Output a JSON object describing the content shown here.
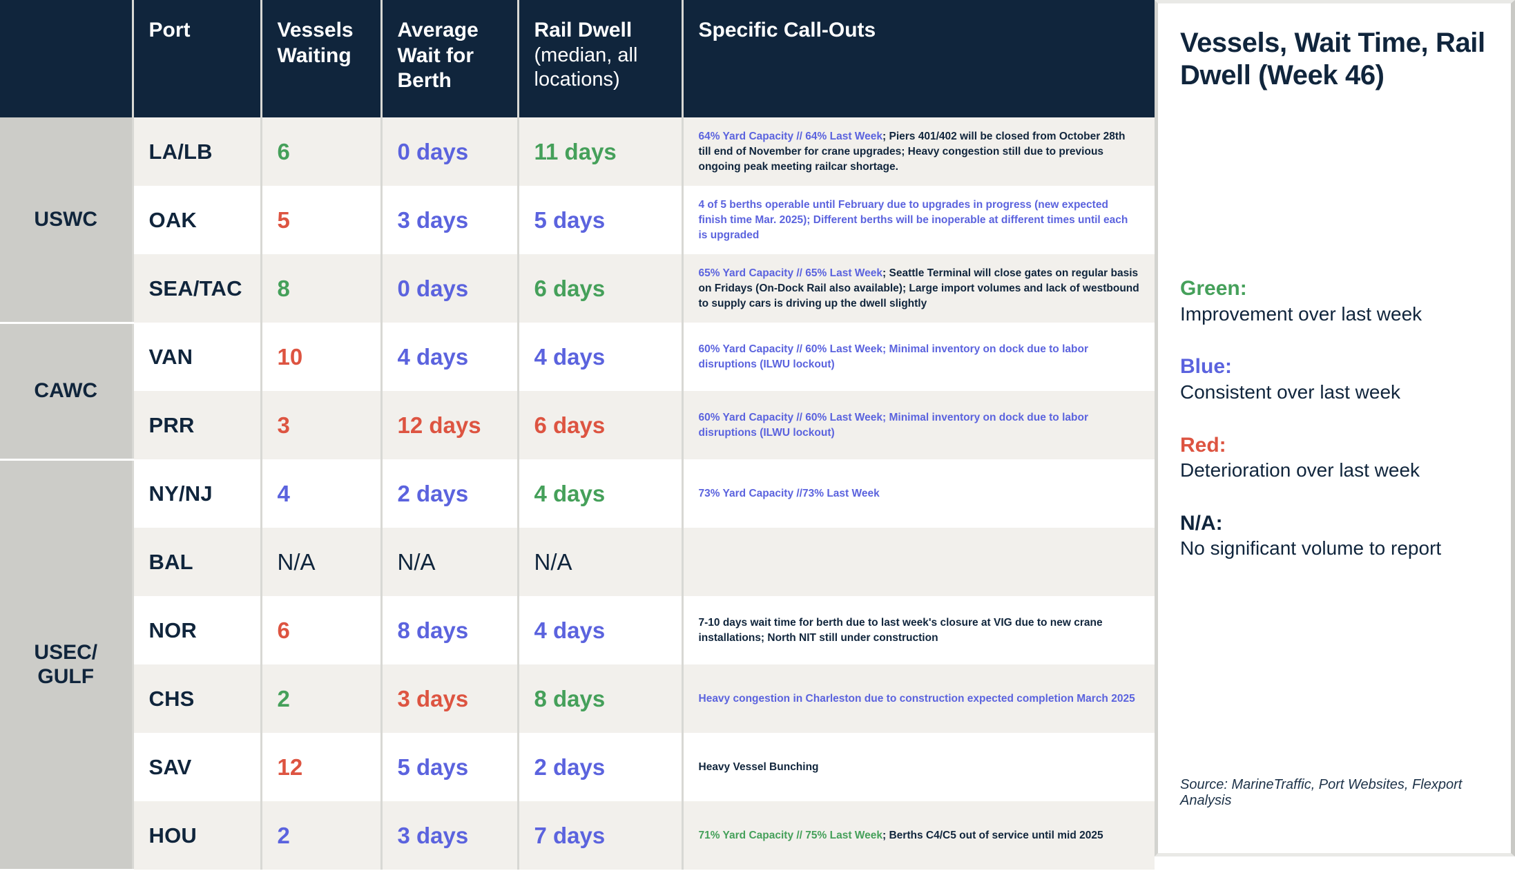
{
  "table": {
    "columns": [
      {
        "label": "",
        "sub": ""
      },
      {
        "label": "Port",
        "sub": ""
      },
      {
        "label": "Vessels Waiting",
        "sub": ""
      },
      {
        "label": "Average Wait for Berth",
        "sub": ""
      },
      {
        "label": "Rail Dwell",
        "sub": "(median, all locations)"
      },
      {
        "label": "Specific Call-Outs",
        "sub": ""
      }
    ],
    "regions": [
      {
        "name": "USWC",
        "rows": 3
      },
      {
        "name": "CAWC",
        "rows": 2
      },
      {
        "name": "USEC/ GULF",
        "rows": 6
      }
    ],
    "rows": [
      {
        "port": "LA/LB",
        "vessels": "6",
        "vessels_color": "green",
        "wait": "0 days",
        "wait_color": "blue",
        "dwell": "11 days",
        "dwell_color": "green",
        "note_hl": "64% Yard Capacity // 64% Last Week",
        "note_hl_color": "blue",
        "note_rest": "; Piers 401/402 will be closed from October 28th till end of November for crane upgrades; Heavy congestion still due to previous ongoing peak meeting railcar shortage."
      },
      {
        "port": "OAK",
        "vessels": "5",
        "vessels_color": "red",
        "wait": "3 days",
        "wait_color": "blue",
        "dwell": "5 days",
        "dwell_color": "blue",
        "note_hl": "4 of 5 berths operable until February due to upgrades in progress (new expected finish time Mar. 2025); Different berths will be inoperable at different times until each is upgraded",
        "note_hl_color": "blue",
        "note_rest": ""
      },
      {
        "port": "SEA/TAC",
        "vessels": "8",
        "vessels_color": "green",
        "wait": "0 days",
        "wait_color": "blue",
        "dwell": "6 days",
        "dwell_color": "green",
        "note_hl": "65% Yard Capacity // 65% Last Week",
        "note_hl_color": "blue",
        "note_rest": "; Seattle Terminal will close gates on regular basis on Fridays (On-Dock Rail also available); Large import volumes and lack of westbound to supply cars is driving up the dwell slightly"
      },
      {
        "port": "VAN",
        "vessels": "10",
        "vessels_color": "red",
        "wait": "4 days",
        "wait_color": "blue",
        "dwell": "4 days",
        "dwell_color": "blue",
        "note_hl": "60% Yard Capacity // 60% Last Week; Minimal inventory on dock due to labor disruptions (ILWU lockout)",
        "note_hl_color": "blue",
        "note_rest": ""
      },
      {
        "port": "PRR",
        "vessels": "3",
        "vessels_color": "red",
        "wait": "12 days",
        "wait_color": "red",
        "dwell": "6 days",
        "dwell_color": "red",
        "note_hl": "60% Yard Capacity // 60% Last Week; Minimal inventory on dock due to labor disruptions (ILWU lockout)",
        "note_hl_color": "blue",
        "note_rest": ""
      },
      {
        "port": "NY/NJ",
        "vessels": "4",
        "vessels_color": "blue",
        "wait": "2 days",
        "wait_color": "blue",
        "dwell": "4 days",
        "dwell_color": "green",
        "note_hl": "73% Yard Capacity //73% Last Week",
        "note_hl_color": "blue",
        "note_rest": ""
      },
      {
        "port": "BAL",
        "vessels": "N/A",
        "vessels_color": "dark",
        "wait": "N/A",
        "wait_color": "dark",
        "dwell": "N/A",
        "dwell_color": "dark",
        "note_hl": "",
        "note_hl_color": "blue",
        "note_rest": ""
      },
      {
        "port": "NOR",
        "vessels": "6",
        "vessels_color": "red",
        "wait": "8 days",
        "wait_color": "blue",
        "dwell": "4 days",
        "dwell_color": "blue",
        "note_hl": "",
        "note_hl_color": "dark",
        "note_rest": "7-10 days wait time for berth due to last week's closure at VIG due to new crane installations; North NIT still under construction"
      },
      {
        "port": "CHS",
        "vessels": "2",
        "vessels_color": "green",
        "wait": "3 days",
        "wait_color": "red",
        "dwell": "8 days",
        "dwell_color": "green",
        "note_hl": "Heavy congestion in Charleston due to construction expected completion March 2025",
        "note_hl_color": "blue",
        "note_rest": ""
      },
      {
        "port": "SAV",
        "vessels": "12",
        "vessels_color": "red",
        "wait": "5 days",
        "wait_color": "blue",
        "dwell": "2 days",
        "dwell_color": "blue",
        "note_hl": "",
        "note_hl_color": "dark",
        "note_rest": "Heavy Vessel Bunching"
      },
      {
        "port": "HOU",
        "vessels": "2",
        "vessels_color": "blue",
        "wait": "3 days",
        "wait_color": "blue",
        "dwell": "7 days",
        "dwell_color": "blue",
        "note_hl": "71% Yard Capacity // 75% Last Week",
        "note_hl_color": "green",
        "note_rest": "; Berths C4/C5 out of service until mid 2025"
      }
    ]
  },
  "legend": {
    "title": "Vessels, Wait Time, Rail Dwell (Week 46)",
    "items": [
      {
        "key": "Green:",
        "key_color": "green",
        "desc": "Improvement over last week"
      },
      {
        "key": "Blue:",
        "key_color": "blue",
        "desc": "Consistent over last week"
      },
      {
        "key": "Red:",
        "key_color": "red",
        "desc": "Deterioration over last week"
      },
      {
        "key": "N/A:",
        "key_color": "dark",
        "desc": "No significant volume to report"
      }
    ],
    "source": "Source: MarineTraffic, Port Websites, Flexport Analysis"
  },
  "colors": {
    "green": "#45A05A",
    "blue": "#5B63DE",
    "red": "#DD5441",
    "dark": "#10253C",
    "header_bg": "#10253C",
    "region_bg": "#CCCCC8",
    "row_alt_bg": "#F2F0EC"
  }
}
